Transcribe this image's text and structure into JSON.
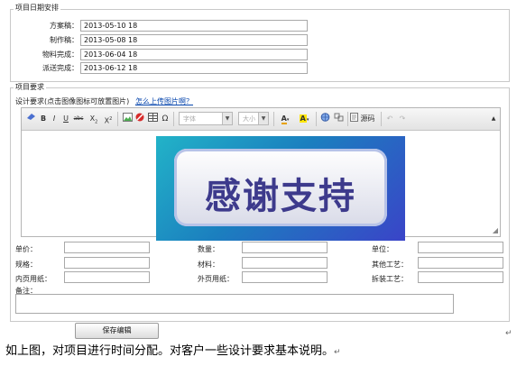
{
  "schedule": {
    "legend": "项目日期安排",
    "rows": [
      {
        "label": "方案稿：",
        "value": "2013-05-10 18"
      },
      {
        "label": "制作稿：",
        "value": "2013-05-08 18"
      },
      {
        "label": "物料完成：",
        "value": "2013-06-04 18"
      },
      {
        "label": "派送完成：",
        "value": "2013-06-12 18"
      }
    ]
  },
  "requirements": {
    "legend": "项目要求",
    "design_label": "设计要求(点击图像图标可放置图片)",
    "help_link": "怎么上传图片啊？",
    "toolbar": {
      "font_placeholder": "字体",
      "size_placeholder": "大小",
      "source_label": "源码",
      "buttons": [
        "eraser",
        "B",
        "I",
        "U",
        "abc",
        "X₂",
        "X²",
        "image",
        "flash",
        "table",
        "Ω",
        "font-color",
        "bg-color",
        "link",
        "unlink",
        "source",
        "undo",
        "redo"
      ]
    },
    "banner_text": "感谢支持",
    "fields": {
      "unit_price": "单价：",
      "quantity": "数量：",
      "unit": "单位：",
      "spec": "规格：",
      "material": "材料：",
      "other_process": "其他工艺：",
      "inner_paper": "内页用纸：",
      "outer_paper": "外页用纸：",
      "binding_process": "拆装工艺：",
      "remarks": "备注："
    }
  },
  "save_button": "保存编辑",
  "caption": "如上图，对项目进行时间分配。对客户一些设计要求基本说明。",
  "colors": {
    "link": "#0645ad",
    "banner_start": "#22b3c8",
    "banner_end": "#3a44c8",
    "banner_text": "#3d3a8c"
  }
}
